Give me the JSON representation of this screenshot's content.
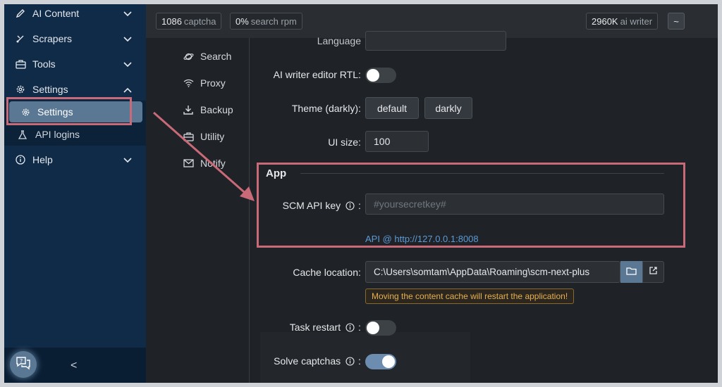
{
  "sidebar": {
    "items": [
      {
        "label": "AI Content",
        "icon": "pencil-icon"
      },
      {
        "label": "Scrapers",
        "icon": "scraper-icon"
      },
      {
        "label": "Tools",
        "icon": "toolbox-icon"
      },
      {
        "label": "Settings",
        "icon": "gear-icon"
      },
      {
        "label": "Help",
        "icon": "help-icon"
      }
    ],
    "sub_items": [
      {
        "label": "Settings",
        "icon": "gear-icon"
      },
      {
        "label": "API logins",
        "icon": "flask-icon"
      }
    ],
    "collapse_label": "<"
  },
  "topbar": {
    "captcha_count": "1086",
    "captcha_label": "captcha",
    "search_rpm_count": "0%",
    "search_rpm_label": "search rpm",
    "ai_writer_count": "2960K",
    "ai_writer_label": "ai writer",
    "menu_label": "~"
  },
  "subnav": {
    "items": [
      {
        "label": "Search",
        "icon": "planet-icon"
      },
      {
        "label": "Proxy",
        "icon": "wifi-icon"
      },
      {
        "label": "Backup",
        "icon": "download-icon"
      },
      {
        "label": "Utility",
        "icon": "toolbox-icon"
      },
      {
        "label": "Notify",
        "icon": "envelope-icon"
      }
    ]
  },
  "form": {
    "language_label": "Language",
    "rtl_label": "AI writer editor RTL",
    "rtl_on": false,
    "theme_label": "Theme (darkly)",
    "theme_options": [
      "default",
      "darkly"
    ],
    "ui_size_label": "UI size",
    "ui_size_value": "100",
    "app_section_title": "App",
    "api_key_label": "SCM API key",
    "api_key_placeholder": "#yoursecretkey#",
    "api_link": "API @ http://127.0.0.1:8008",
    "cache_label": "Cache location",
    "cache_value": "C:\\Users\\somtam\\AppData\\Roaming\\scm-next-plus",
    "cache_warning": "Moving the content cache will restart the application!",
    "task_restart_label": "Task restart",
    "task_restart_on": false,
    "solve_captchas_label": "Solve captchas",
    "solve_captchas_on": true
  },
  "colors": {
    "sidebar_bg": "#0f2b47",
    "accent": "#5a7894",
    "highlight_annotation": "#c96a78",
    "link": "#5c9bd6",
    "warning": "#e6b04e"
  }
}
